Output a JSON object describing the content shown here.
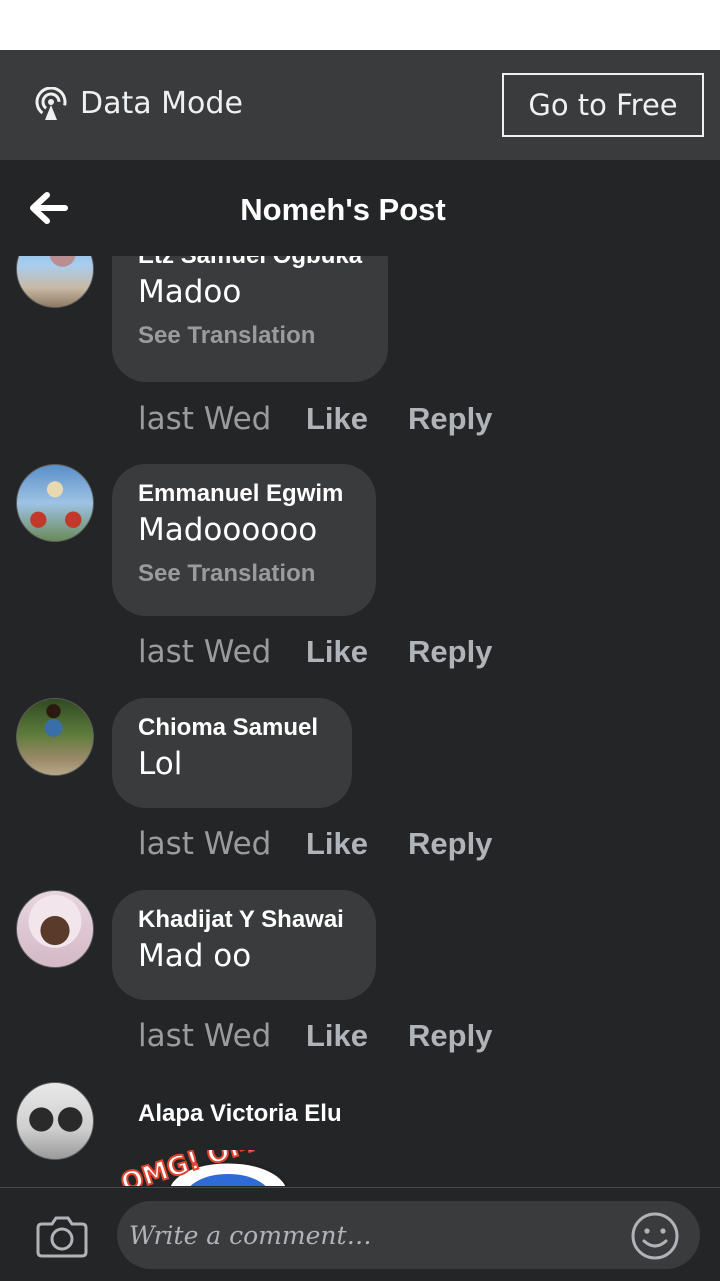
{
  "data_bar": {
    "mode_label": "Data Mode",
    "go_free_label": "Go to Free"
  },
  "header": {
    "title": "Nomeh's Post"
  },
  "comments": [
    {
      "author": "Etz Samuel Ogbuka",
      "text": "Madoo",
      "translation": "See Translation",
      "time": "last Wed",
      "like": "Like",
      "reply": "Reply"
    },
    {
      "author": "Emmanuel Egwim",
      "text": "Madoooooo",
      "translation": "See Translation",
      "time": "last Wed",
      "like": "Like",
      "reply": "Reply"
    },
    {
      "author": "Chioma Samuel",
      "text": "Lol",
      "time": "last Wed",
      "like": "Like",
      "reply": "Reply"
    },
    {
      "author": "Khadijat Y Shawai",
      "text": "Mad oo",
      "time": "last Wed",
      "like": "Like",
      "reply": "Reply"
    },
    {
      "author": "Alapa Victoria Elu",
      "sticker": "OMG! OMG"
    }
  ],
  "composer": {
    "placeholder": "Write a comment…"
  },
  "icons": {
    "data_mode": "broadcast-icon",
    "back": "arrow-left-icon",
    "camera": "camera-icon",
    "emoji": "smiley-icon"
  }
}
